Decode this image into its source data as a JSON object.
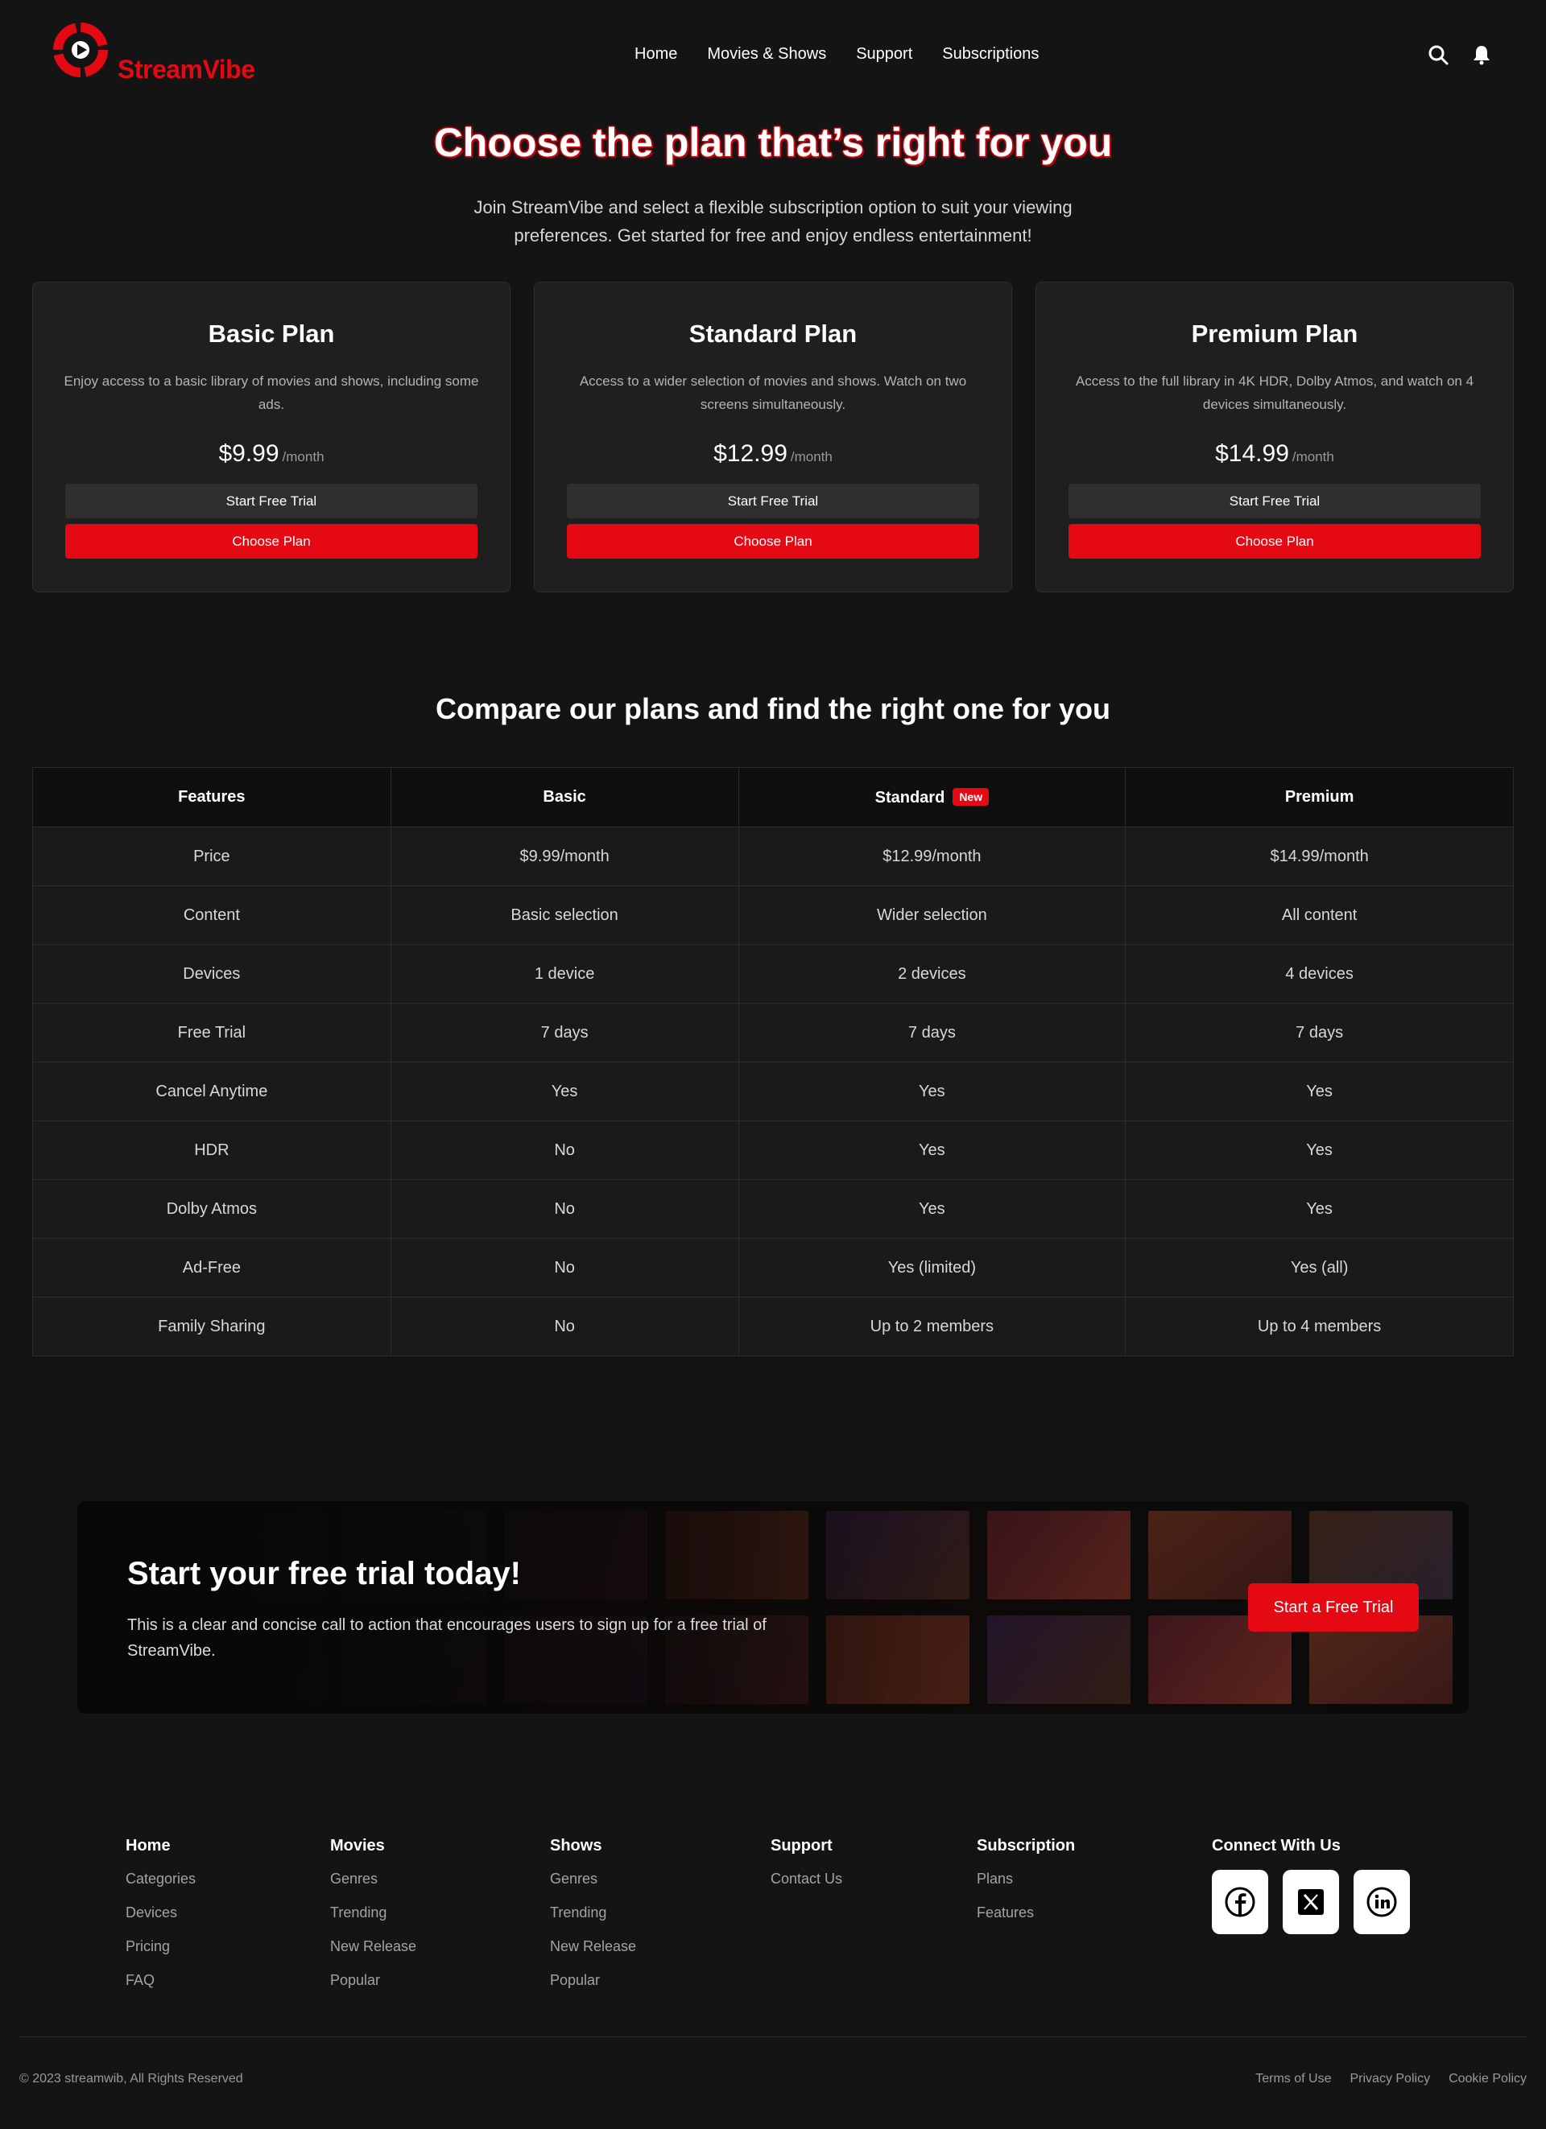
{
  "brand": {
    "name": "StreamVibe",
    "accent_color": "#e50914",
    "background_color": "#141414"
  },
  "nav": {
    "items": [
      "Home",
      "Movies & Shows",
      "Support",
      "Subscriptions"
    ]
  },
  "header_icons": [
    "search-icon",
    "bell-icon"
  ],
  "hero": {
    "title": "Choose the plan that’s right for you",
    "subtitle": "Join StreamVibe and select a flexible subscription option to suit your viewing preferences. Get started for free and enjoy endless entertainment!"
  },
  "plans": [
    {
      "name": "Basic Plan",
      "description": "Enjoy access to a basic library of movies and shows, including some ads.",
      "price": "$9.99",
      "period": "/month",
      "trial_label": "Start Free Trial",
      "choose_label": "Choose Plan"
    },
    {
      "name": "Standard Plan",
      "description": "Access to a wider selection of movies and shows. Watch on two screens simultaneously.",
      "price": "$12.99",
      "period": "/month",
      "trial_label": "Start Free Trial",
      "choose_label": "Choose Plan"
    },
    {
      "name": "Premium Plan",
      "description": "Access to the full library in 4K HDR, Dolby Atmos, and watch on 4 devices simultaneously.",
      "price": "$14.99",
      "period": "/month",
      "trial_label": "Start Free Trial",
      "choose_label": "Choose Plan"
    }
  ],
  "compare": {
    "title": "Compare our plans and find the right one for you",
    "headers": [
      "Features",
      "Basic",
      "Standard",
      "Premium"
    ],
    "new_badge": "New",
    "rows": [
      [
        "Price",
        "$9.99/month",
        "$12.99/month",
        "$14.99/month"
      ],
      [
        "Content",
        "Basic selection",
        "Wider selection",
        "All content"
      ],
      [
        "Devices",
        "1 device",
        "2 devices",
        "4 devices"
      ],
      [
        "Free Trial",
        "7 days",
        "7 days",
        "7 days"
      ],
      [
        "Cancel Anytime",
        "Yes",
        "Yes",
        "Yes"
      ],
      [
        "HDR",
        "No",
        "Yes",
        "Yes"
      ],
      [
        "Dolby Atmos",
        "No",
        "Yes",
        "Yes"
      ],
      [
        "Ad-Free",
        "No",
        "Yes (limited)",
        "Yes (all)"
      ],
      [
        "Family Sharing",
        "No",
        "Up to 2 members",
        "Up to 4 members"
      ]
    ]
  },
  "cta": {
    "title": "Start your free trial today!",
    "text": "This is a clear and concise call to action that encourages users to sign up for a free trial of StreamVibe.",
    "button": "Start a Free Trial"
  },
  "footer": {
    "columns": [
      {
        "title": "Home",
        "links": [
          "Categories",
          "Devices",
          "Pricing",
          "FAQ"
        ]
      },
      {
        "title": "Movies",
        "links": [
          "Genres",
          "Trending",
          "New Release",
          "Popular"
        ]
      },
      {
        "title": "Shows",
        "links": [
          "Genres",
          "Trending",
          "New Release",
          "Popular"
        ]
      },
      {
        "title": "Support",
        "links": [
          "Contact Us"
        ]
      },
      {
        "title": "Subscription",
        "links": [
          "Plans",
          "Features"
        ]
      }
    ],
    "connect_title": "Connect With Us",
    "socials": [
      "facebook-icon",
      "x-icon",
      "linkedin-icon"
    ],
    "copyright": "© 2023 streamwib, All Rights Reserved",
    "legal": [
      "Terms of Use",
      "Privacy Policy",
      "Cookie Policy"
    ]
  }
}
